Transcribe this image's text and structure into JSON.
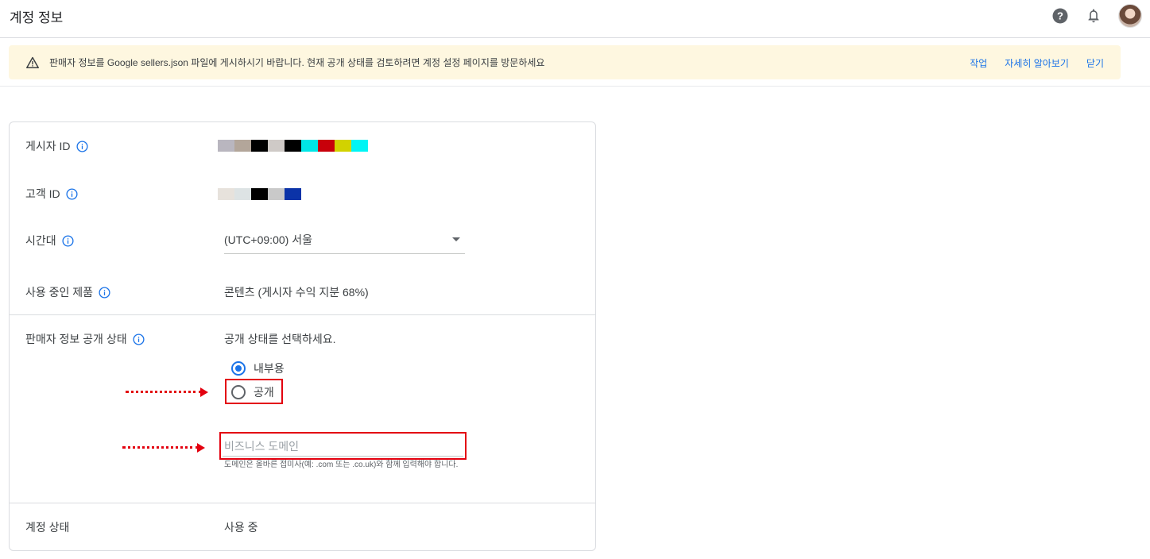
{
  "header": {
    "title": "계정 정보"
  },
  "banner": {
    "text": "판매자 정보를 Google sellers.json 파일에 게시하시기 바랍니다. 현재 공개 상태를 검토하려면 계정 설정 페이지를 방문하세요",
    "actions": [
      "작업",
      "자세히 알아보기",
      "닫기"
    ]
  },
  "fields": {
    "publisher_id_label": "게시자 ID",
    "customer_id_label": "고객 ID",
    "timezone_label": "시간대",
    "timezone_value": "(UTC+09:00) 서울",
    "products_label": "사용 중인 제품",
    "products_value": "콘텐츠 (게시자 수익 지분 68%)",
    "seller_visibility_label": "판매자 정보 공개 상태",
    "seller_visibility_prompt": "공개 상태를 선택하세요.",
    "radio_internal": "내부용",
    "radio_public": "공개",
    "domain_placeholder": "비즈니스 도메인",
    "domain_helper": "도메인은 올바른 접미사(예: .com 또는 .co.uk)와 함께 입력해야 합니다.",
    "account_status_label": "계정 상태",
    "account_status_value": "사용 중"
  },
  "redacted_publisher_colors": [
    "#b9b6bf",
    "#b3a69a",
    "#000000",
    "#cfcac7",
    "#000000",
    "#00e6e6",
    "#c8000a",
    "#d2d200",
    "#00f5f5"
  ],
  "redacted_customer_colors": [
    "#e7e2dc",
    "#dde3e4",
    "#000000",
    "#c9c9c9",
    "#0b33a8"
  ],
  "colors": {
    "accent": "#1a73e8",
    "banner_bg": "#fef7e0",
    "annotation_red": "#e3000f"
  }
}
